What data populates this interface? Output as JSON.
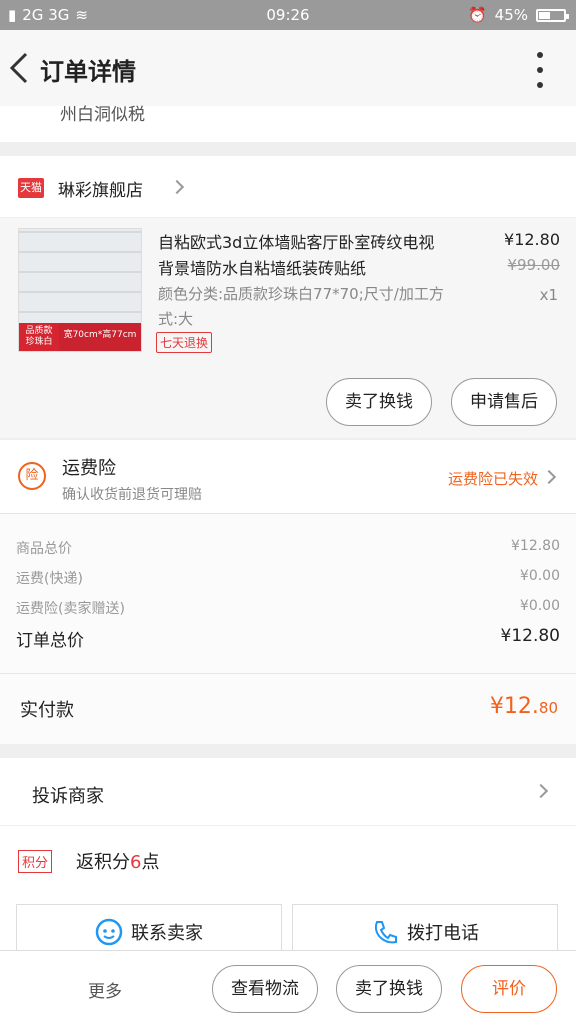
{
  "status_bar": {
    "signal": "2G 3G",
    "time": "09:26",
    "battery": "45%",
    "battery_level": 0.45
  },
  "header": {
    "title": "订单详情"
  },
  "partial_text": "州白洞似税",
  "store": {
    "platform_tag": "天猫",
    "name": "琳彩旗舰店"
  },
  "product": {
    "title": "自粘欧式3d立体墙贴客厅卧室砖纹电视背景墙防水自粘墙纸装砖贴纸",
    "spec": "颜色分类:品质款珍珠白77*70;尺寸/加工方式:大",
    "thumb_tag_1": "品质款",
    "thumb_tag_1b": "珍珠白",
    "thumb_tag_2": "宽70cm*高77cm",
    "badge": "七天退换",
    "price": "¥12.80",
    "original_price": "¥99.00",
    "quantity": "x1",
    "buttons": [
      "卖了换钱",
      "申请售后"
    ]
  },
  "insurance": {
    "icon_text": "险",
    "title": "运费险",
    "subtitle": "确认收货前退货可理赔",
    "status": "运费险已失效"
  },
  "summary": {
    "rows": [
      {
        "label": "商品总价",
        "value": "¥12.80"
      },
      {
        "label": "运费(快递)",
        "value": "¥0.00"
      },
      {
        "label": "运费险(卖家赠送)",
        "value": "¥0.00"
      }
    ],
    "total_label": "订单总价",
    "total_value": "¥12.80"
  },
  "paid": {
    "label": "实付款",
    "value_main": "¥12.",
    "value_cents": "80"
  },
  "complain": {
    "label": "投诉商家"
  },
  "points": {
    "tag": "积分",
    "prefix": "返积分",
    "number": "6",
    "suffix": "点"
  },
  "contact": {
    "seller": "联系卖家",
    "phone": "拨打电话"
  },
  "bottom_bar": {
    "more": "更多",
    "logistics": "查看物流",
    "refund": "卖了换钱",
    "review": "评价"
  },
  "colors": {
    "accent": "#f0621e",
    "tmall_red": "#e4393c"
  }
}
